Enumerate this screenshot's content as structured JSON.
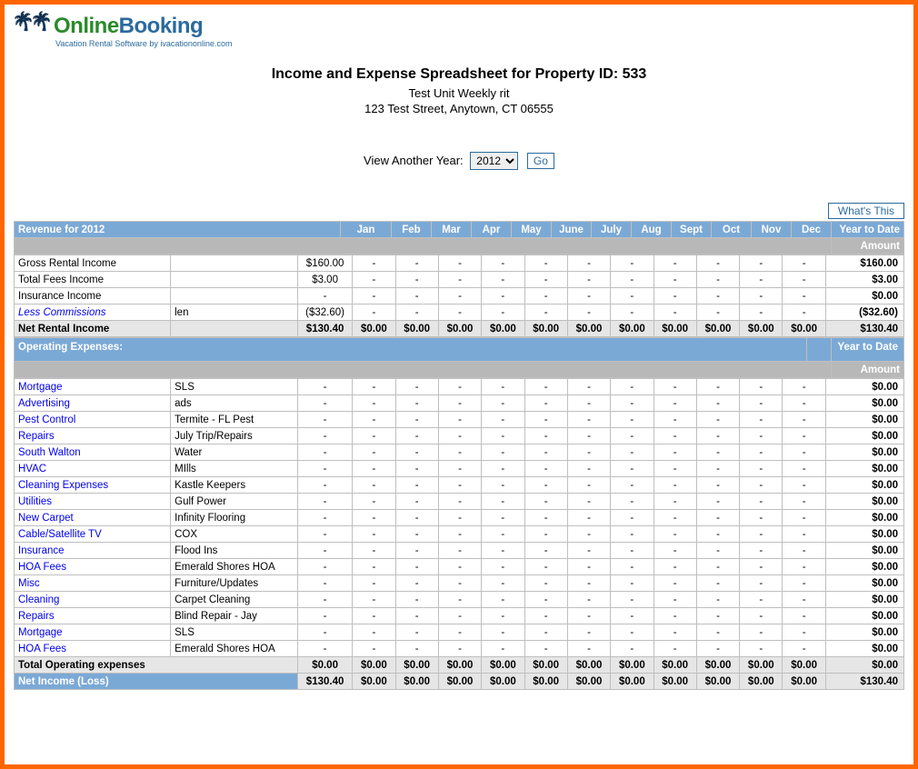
{
  "logo": {
    "line1a": "Online",
    "line1b": "Booking",
    "line2": "Vacation Rental Software by ivacationonline.com"
  },
  "header": {
    "title": "Income and Expense Spreadsheet for Property ID: 533",
    "sub1": "Test Unit Weekly rit",
    "sub2": "123 Test Street, Anytown, CT 06555"
  },
  "year_picker": {
    "label": "View Another Year:",
    "selected": "2012",
    "go": "Go"
  },
  "whats_this": "What's This",
  "months": [
    "Jan",
    "Feb",
    "Mar",
    "Apr",
    "May",
    "June",
    "July",
    "Aug",
    "Sept",
    "Oct",
    "Nov",
    "Dec"
  ],
  "revenue": {
    "header_label": "Revenue for 2012",
    "ytd_top": "Year to Date",
    "ytd_sub": "Amount",
    "rows": [
      {
        "label": "Gross Rental Income",
        "detail": "",
        "vals": [
          "$160.00",
          "-",
          "-",
          "-",
          "-",
          "-",
          "-",
          "-",
          "-",
          "-",
          "-",
          "-"
        ],
        "ytd": "$160.00",
        "link": false
      },
      {
        "label": "Total Fees Income",
        "detail": "",
        "vals": [
          "$3.00",
          "-",
          "-",
          "-",
          "-",
          "-",
          "-",
          "-",
          "-",
          "-",
          "-",
          "-"
        ],
        "ytd": "$3.00",
        "link": false
      },
      {
        "label": "Insurance Income",
        "detail": "",
        "vals": [
          "-",
          "-",
          "-",
          "-",
          "-",
          "-",
          "-",
          "-",
          "-",
          "-",
          "-",
          "-"
        ],
        "ytd": "$0.00",
        "link": false
      },
      {
        "label": "Less Commissions",
        "detail": "len",
        "vals": [
          "($32.60)",
          "-",
          "-",
          "-",
          "-",
          "-",
          "-",
          "-",
          "-",
          "-",
          "-",
          "-"
        ],
        "ytd": "($32.60)",
        "link": true,
        "italic": true
      }
    ],
    "net": {
      "label": "Net Rental Income",
      "vals": [
        "$130.40",
        "$0.00",
        "$0.00",
        "$0.00",
        "$0.00",
        "$0.00",
        "$0.00",
        "$0.00",
        "$0.00",
        "$0.00",
        "$0.00",
        "$0.00"
      ],
      "ytd": "$130.40"
    }
  },
  "expenses": {
    "header_label": "Operating Expenses:",
    "ytd_top": "Year to Date",
    "ytd_sub": "Amount",
    "rows": [
      {
        "label": "Mortgage",
        "detail": "SLS",
        "ytd": "$0.00"
      },
      {
        "label": "Advertising",
        "detail": "ads",
        "ytd": "$0.00"
      },
      {
        "label": "Pest Control",
        "detail": "Termite - FL Pest",
        "ytd": "$0.00"
      },
      {
        "label": "Repairs",
        "detail": "July Trip/Repairs",
        "ytd": "$0.00"
      },
      {
        "label": "South Walton",
        "detail": "Water",
        "ytd": "$0.00"
      },
      {
        "label": "HVAC",
        "detail": "MIlls",
        "ytd": "$0.00"
      },
      {
        "label": "Cleaning Expenses",
        "detail": "Kastle Keepers",
        "ytd": "$0.00"
      },
      {
        "label": "Utilities",
        "detail": "Gulf Power",
        "ytd": "$0.00"
      },
      {
        "label": "New Carpet",
        "detail": "Infinity Flooring",
        "ytd": "$0.00"
      },
      {
        "label": "Cable/Satellite TV",
        "detail": "COX",
        "ytd": "$0.00"
      },
      {
        "label": "Insurance",
        "detail": "Flood Ins",
        "ytd": "$0.00"
      },
      {
        "label": "HOA Fees",
        "detail": "Emerald Shores HOA",
        "ytd": "$0.00"
      },
      {
        "label": "Misc",
        "detail": "Furniture/Updates",
        "ytd": "$0.00"
      },
      {
        "label": "Cleaning",
        "detail": "Carpet Cleaning",
        "ytd": "$0.00"
      },
      {
        "label": "Repairs",
        "detail": "Blind Repair - Jay",
        "ytd": "$0.00"
      },
      {
        "label": "Mortgage",
        "detail": "SLS",
        "ytd": "$0.00"
      },
      {
        "label": "HOA Fees",
        "detail": "Emerald Shores HOA",
        "ytd": "$0.00"
      }
    ],
    "total": {
      "label": "Total Operating expenses",
      "vals": [
        "$0.00",
        "$0.00",
        "$0.00",
        "$0.00",
        "$0.00",
        "$0.00",
        "$0.00",
        "$0.00",
        "$0.00",
        "$0.00",
        "$0.00",
        "$0.00"
      ],
      "ytd": "$0.00"
    },
    "net": {
      "label": "Net Income (Loss)",
      "vals": [
        "$130.40",
        "$0.00",
        "$0.00",
        "$0.00",
        "$0.00",
        "$0.00",
        "$0.00",
        "$0.00",
        "$0.00",
        "$0.00",
        "$0.00",
        "$0.00"
      ],
      "ytd": "$130.40"
    }
  }
}
